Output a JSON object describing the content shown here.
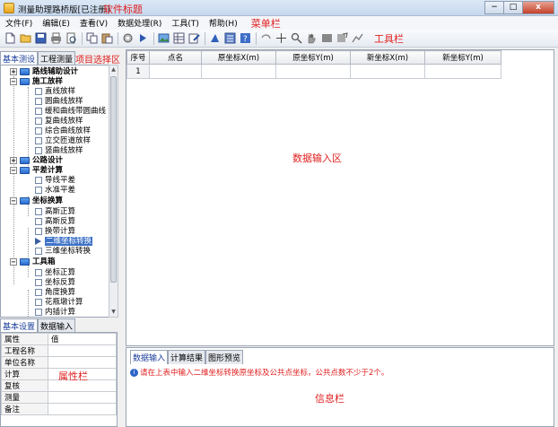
{
  "window": {
    "title": "测量助理路桥版[已注册]",
    "title_annotation": "软件标题",
    "min_label": "−",
    "max_label": "□",
    "close_label": "x"
  },
  "menu": {
    "items": [
      "文件(F)",
      "编辑(E)",
      "查看(V)",
      "数据处理(R)",
      "工具(T)",
      "帮助(H)"
    ],
    "annotation": "菜单栏"
  },
  "toolbar": {
    "annotation": "工具栏",
    "icons": [
      "new-icon",
      "open-icon",
      "save-icon",
      "print-icon",
      "preview-icon",
      "copy-icon",
      "paste-icon",
      "settings-icon",
      "run-icon",
      "image-icon",
      "table-icon",
      "edit-icon",
      "chart-icon",
      "calc-icon",
      "help-icon",
      "undo-icon",
      "crosshair-icon",
      "zoom-icon",
      "pan-icon",
      "rect-icon",
      "measure-icon",
      "draw-icon"
    ]
  },
  "left": {
    "tabs": [
      "基本测设",
      "工程测量"
    ],
    "tab_annotation": "项目选择区",
    "tree": [
      {
        "label": "路线辅助设计",
        "type": "folder",
        "expander": "+"
      },
      {
        "label": "施工放样",
        "type": "folder",
        "expander": "−"
      },
      {
        "label": "直线放样",
        "type": "leaf"
      },
      {
        "label": "圆曲线放样",
        "type": "leaf"
      },
      {
        "label": "缓和曲线带圆曲线",
        "type": "leaf"
      },
      {
        "label": "复曲线放样",
        "type": "leaf"
      },
      {
        "label": "综合曲线放样",
        "type": "leaf"
      },
      {
        "label": "立交匝道放样",
        "type": "leaf"
      },
      {
        "label": "竖曲线放样",
        "type": "leaf"
      },
      {
        "label": "公路设计",
        "type": "folder",
        "expander": "+"
      },
      {
        "label": "平差计算",
        "type": "folder",
        "expander": "−"
      },
      {
        "label": "导线平差",
        "type": "leaf"
      },
      {
        "label": "水准平差",
        "type": "leaf"
      },
      {
        "label": "坐标换算",
        "type": "folder",
        "expander": "−"
      },
      {
        "label": "高斯正算",
        "type": "leaf"
      },
      {
        "label": "高斯反算",
        "type": "leaf"
      },
      {
        "label": "换带计算",
        "type": "leaf"
      },
      {
        "label": "二维坐标转换",
        "type": "selected"
      },
      {
        "label": "三维坐标转换",
        "type": "leaf"
      },
      {
        "label": "工具箱",
        "type": "folder",
        "expander": "−"
      },
      {
        "label": "坐标正算",
        "type": "leaf"
      },
      {
        "label": "坐标反算",
        "type": "leaf"
      },
      {
        "label": "角度换算",
        "type": "leaf"
      },
      {
        "label": "花瓶墩计算",
        "type": "leaf"
      },
      {
        "label": "内插计算",
        "type": "leaf"
      }
    ],
    "bottom_tabs": [
      "基本设置",
      "数据输入"
    ],
    "props_header": [
      "属性",
      "值"
    ],
    "props_rows": [
      "工程名称",
      "单位名称",
      "计算",
      "复核",
      "测量",
      "备注"
    ],
    "props_annotation": "属性栏"
  },
  "grid": {
    "headers": [
      "序号",
      "点名",
      "原坐标X(m)",
      "原坐标Y(m)",
      "新坐标X(m)",
      "新坐标Y(m)"
    ],
    "rows": [
      [
        "1",
        "",
        "",
        "",
        "",
        ""
      ]
    ],
    "annotation": "数据输入区"
  },
  "info": {
    "tabs": [
      "数据输入",
      "计算结果",
      "图形预览"
    ],
    "message": "请在上表中输入二维坐标转换原坐标及公共点坐标，公共点数不少于2个。",
    "annotation": "信息栏"
  }
}
